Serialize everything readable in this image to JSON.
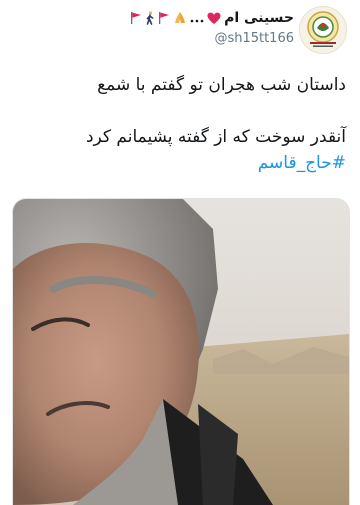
{
  "tweet": {
    "display_name": "حسینی ام",
    "name_decor": [
      "🚩",
      "🚶",
      "🚩",
      "🙏",
      "…",
      "❤️"
    ],
    "handle": "@sh15tt166",
    "lines": [
      "داستان شب هجران تو گفتم با شمع",
      "",
      "آنقدر سوخت که از گفته پشیمانم کرد"
    ],
    "hashtag": "#حاج_قاسم"
  },
  "icons": {
    "avatar": "profile-emblem",
    "media": "portrait-photo"
  },
  "colors": {
    "text": "#14171a",
    "muted": "#657786",
    "link": "#1b95e0",
    "flag": "#e0245e"
  }
}
